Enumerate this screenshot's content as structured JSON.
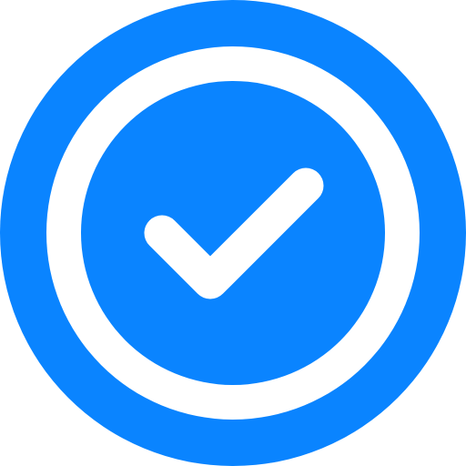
{
  "icon": {
    "name": "check-circle-icon",
    "accent_color": "#0A84FF",
    "foreground_color": "#FFFFFF",
    "background_color": "#FFFFFF"
  }
}
